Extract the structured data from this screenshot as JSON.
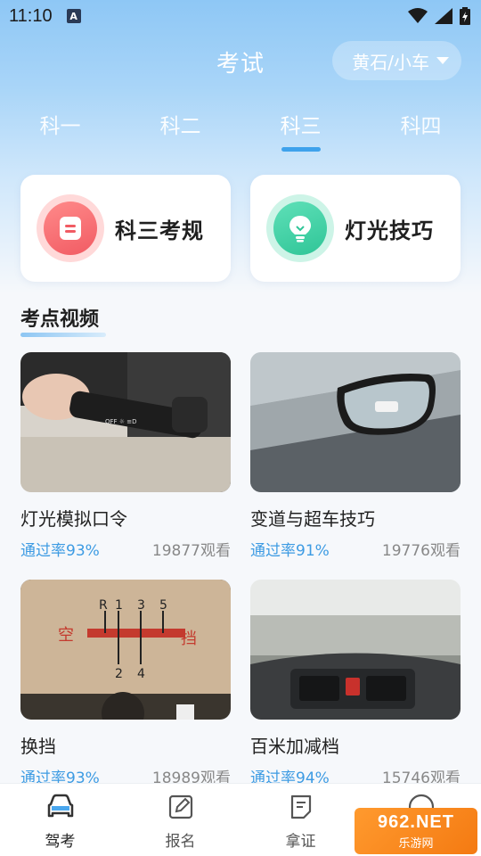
{
  "status_bar": {
    "time": "11:10",
    "notification_badge": "A"
  },
  "header": {
    "title": "考试",
    "city": "黄石/小车"
  },
  "subject_tabs": [
    {
      "label": "科一",
      "active": false
    },
    {
      "label": "科二",
      "active": false
    },
    {
      "label": "科三",
      "active": true
    },
    {
      "label": "科四",
      "active": false
    }
  ],
  "quick_cards": [
    {
      "label": "科三考规",
      "icon": "rules-icon",
      "color": "#f15b63"
    },
    {
      "label": "灯光技巧",
      "icon": "lightbulb-icon",
      "color": "#2fc597"
    }
  ],
  "section_title": "考点视频",
  "videos": [
    {
      "title": "灯光模拟口令",
      "pass_rate": "通过率93%",
      "views": "19877观看",
      "thumb": "light-switch-photo"
    },
    {
      "title": "变道与超车技巧",
      "pass_rate": "通过率91%",
      "views": "19776观看",
      "thumb": "side-mirror-photo"
    },
    {
      "title": "换挡",
      "pass_rate": "通过率93%",
      "views": "18989观看",
      "thumb": "gear-diagram-photo"
    },
    {
      "title": "百米加减档",
      "pass_rate": "通过率94%",
      "views": "15746观看",
      "thumb": "dashboard-road-photo"
    }
  ],
  "gear_diagram": {
    "left": "空",
    "right": "挡",
    "top": [
      "R",
      "1",
      "3",
      "5"
    ],
    "bottom": [
      "2",
      "4"
    ]
  },
  "tab_bar": [
    {
      "label": "驾考",
      "icon": "car-icon",
      "active": true
    },
    {
      "label": "报名",
      "icon": "edit-icon",
      "active": false
    },
    {
      "label": "拿证",
      "icon": "document-icon",
      "active": false
    }
  ],
  "watermark": {
    "line1": "962.NET",
    "line2": "乐游网"
  },
  "colors": {
    "accent": "#3d9be3",
    "header_bg": "#8ec7f5"
  }
}
